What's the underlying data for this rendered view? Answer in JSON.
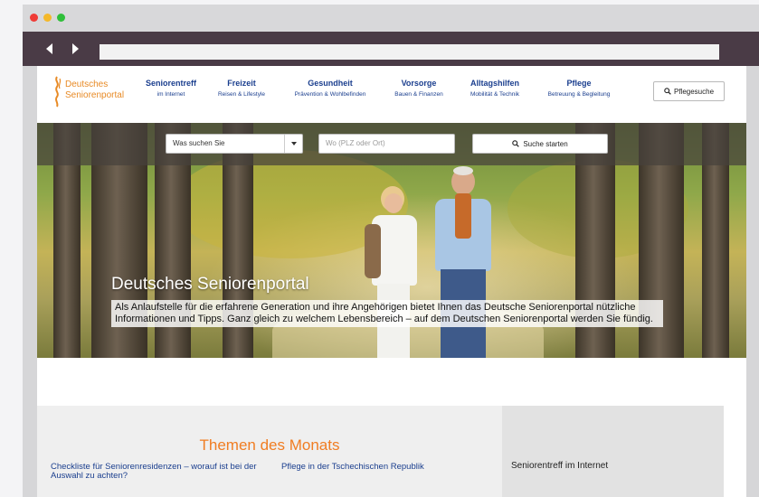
{
  "site": {
    "logo_line1": "Deutsches",
    "logo_line2": "Seniorenportal"
  },
  "nav": [
    {
      "title": "Seniorentreff",
      "subtitle": "im Internet"
    },
    {
      "title": "Freizeit",
      "subtitle": "Reisen & Lifestyle"
    },
    {
      "title": "Gesundheit",
      "subtitle": "Prävention & Wohlbefinden"
    },
    {
      "title": "Vorsorge",
      "subtitle": "Bauen & Finanzen"
    },
    {
      "title": "Alltagshilfen",
      "subtitle": "Mobilität & Technik"
    },
    {
      "title": "Pflege",
      "subtitle": "Betreuung & Begleitung"
    }
  ],
  "pflegesuche": {
    "label": "Pflegesuche",
    "icon": "search-icon"
  },
  "search": {
    "category_selected": "Was suchen Sie",
    "location_placeholder": "Wo (PLZ oder Ort)",
    "button_label": "Suche starten"
  },
  "hero": {
    "title": "Deutsches Seniorenportal",
    "text": "Als Anlaufstelle für die erfahrene Generation und ihre Angehörigen bietet Ihnen das Deutsche Seniorenportal nützliche Informationen und Tipps. Ganz gleich zu welchem Lebensbereich – auf dem Deutschen Seniorenportal werden Sie fündig."
  },
  "themen": {
    "title": "Themen des Monats",
    "items": [
      "Checkliste für Seniorenresidenzen – worauf ist bei der Auswahl zu achten?",
      "Pflege in der Tschechischen Republik"
    ]
  },
  "sidebar": {
    "title": "Seniorentreff im Internet"
  },
  "colors": {
    "accent_orange": "#f07d22",
    "link_blue": "#1a3e8e",
    "browser_toolbar": "#4a3b46"
  }
}
